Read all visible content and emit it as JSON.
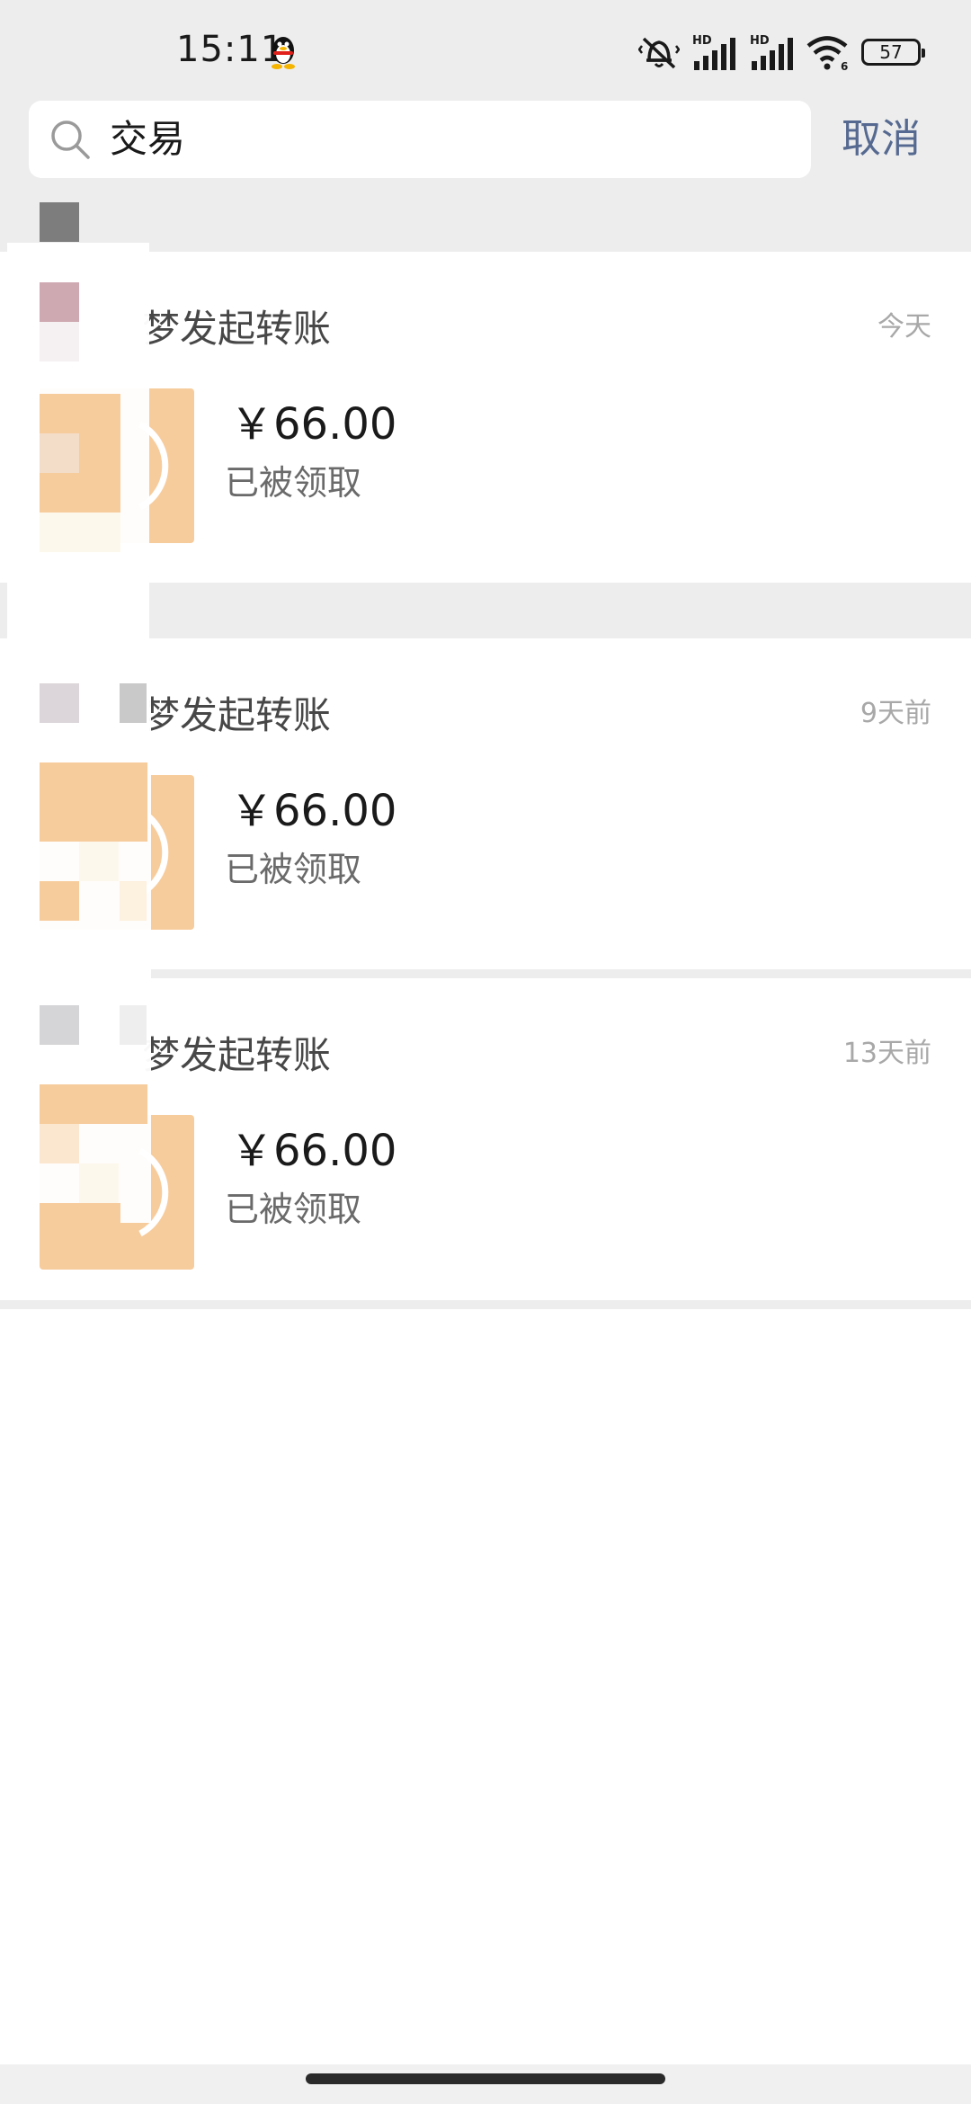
{
  "status_bar": {
    "time": "15:11",
    "notification_icon": "qq-penguin-icon",
    "icons": [
      "vibrate-silent-icon",
      "hd-signal-icon",
      "hd-signal-icon",
      "wifi-6-icon"
    ],
    "signal_badge": "HD",
    "wifi_badge": "6",
    "battery_level": "57"
  },
  "search": {
    "icon": "search-icon",
    "query": "交易",
    "cancel_label": "取消"
  },
  "results": [
    {
      "title": "梦发起转账",
      "date": "今天",
      "amount": "￥66.00",
      "status": "已被领取",
      "icon": "transfer-icon"
    },
    {
      "title": "梦发起转账",
      "date": "9天前",
      "amount": "￥66.00",
      "status": "已被领取",
      "icon": "transfer-icon"
    },
    {
      "title": "梦发起转账",
      "date": "13天前",
      "amount": "￥66.00",
      "status": "已被领取",
      "icon": "transfer-icon"
    }
  ],
  "colors": {
    "background_gray": "#ededed",
    "accent_link": "#566a91",
    "transfer_orange": "#f7cc9d",
    "date_gray": "#a8a8a8"
  }
}
